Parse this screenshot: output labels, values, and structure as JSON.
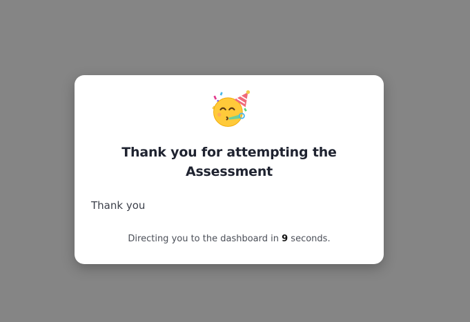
{
  "modal": {
    "icon": "partying-face-icon",
    "title": "Thank you for attempting the Assessment",
    "message": "Thank you",
    "redirect": {
      "prefix": "Directing you to the dashboard in ",
      "seconds": "9",
      "suffix": " seconds."
    }
  },
  "colors": {
    "overlay": "#858585",
    "card": "#ffffff",
    "title_text": "#1f2330",
    "body_text": "#3b3f49"
  }
}
